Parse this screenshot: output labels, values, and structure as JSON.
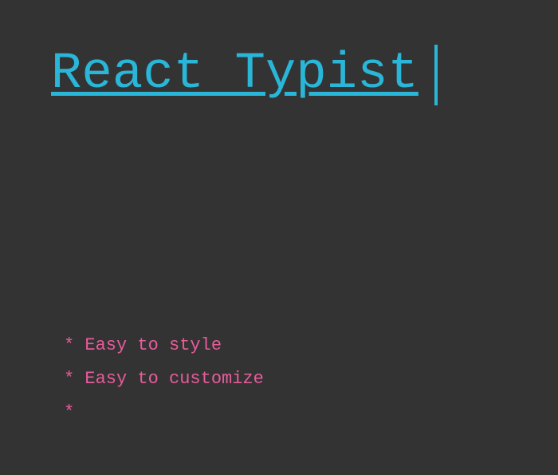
{
  "header": {
    "title": "React Typist",
    "cursor_char": "|"
  },
  "features": {
    "items": [
      "* Easy to style",
      "* Easy to customize",
      "*"
    ]
  },
  "colors": {
    "background": "#333333",
    "title": "#29b6d8",
    "list": "#e75c9c"
  },
  "icons": {
    "typing_cursor": "text-cursor-bar"
  }
}
